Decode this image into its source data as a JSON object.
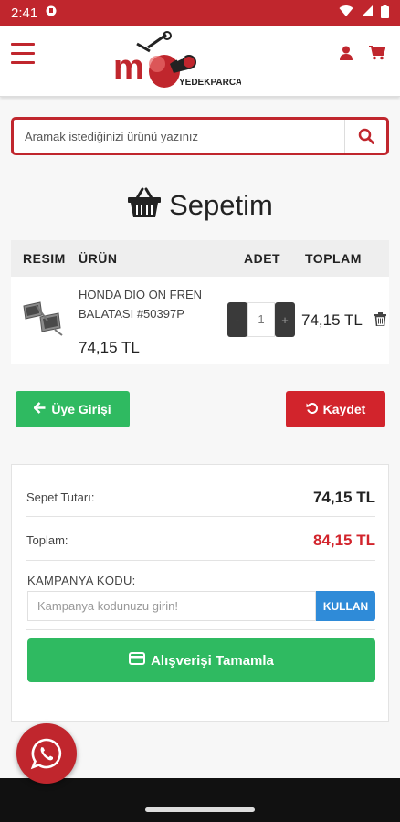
{
  "status_bar": {
    "time": "2:41"
  },
  "header": {
    "logo_text": "YEDEKPARCA",
    "logo_letter": "m",
    "icons": [
      "menu-icon",
      "user-icon",
      "cart-icon"
    ],
    "brand_color": "#c0262d"
  },
  "search": {
    "placeholder": "Aramak istediğinizi ürünü yazınız"
  },
  "page": {
    "title": "Sepetim"
  },
  "cart_table": {
    "headers": {
      "image": "RESIM",
      "product": "ÜRÜN",
      "qty": "ADET",
      "total": "TOPLAM"
    },
    "items": [
      {
        "name": "HONDA DIO ON FREN BALATASI #50397P",
        "price": "74,15 TL",
        "minus": "-",
        "quantity": "1",
        "plus": "+",
        "total": "74,15 TL"
      }
    ]
  },
  "actions": {
    "login": "Üye Girişi",
    "save": "Kaydet"
  },
  "summary": {
    "subtotal_label": "Sepet Tutarı:",
    "subtotal_value": "74,15 TL",
    "total_label": "Toplam:",
    "total_value": "84,15 TL",
    "campaign_label": "KAMPANYA KODU:",
    "campaign_placeholder": "Kampanya kodunuzu girin!",
    "campaign_button": "KULLAN",
    "checkout": "Alışverişi Tamamla"
  },
  "colors": {
    "green": "#2fba61",
    "red": "#d2242c",
    "blue": "#2f8bd8",
    "total_red": "#d2242c"
  }
}
